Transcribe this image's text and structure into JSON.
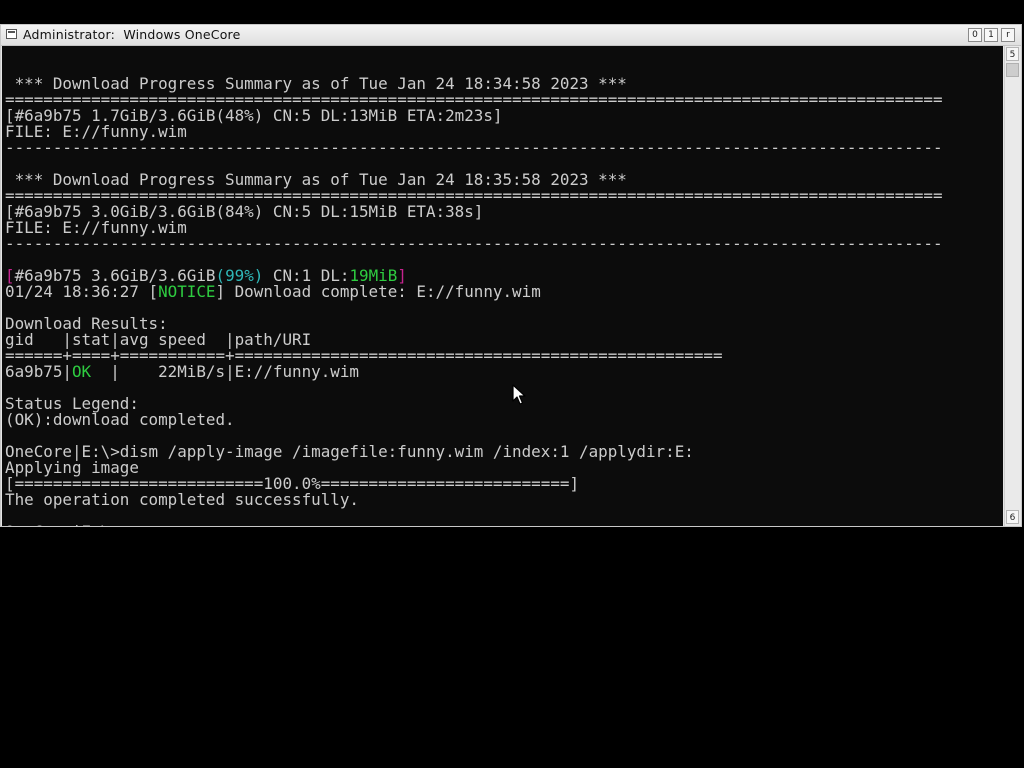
{
  "window": {
    "title": "Administrator:  Windows OneCore",
    "buttons": {
      "minimize": "0",
      "maximize": "1",
      "close": "r"
    }
  },
  "scrollbar": {
    "up_arrow": "5",
    "down_arrow": "6"
  },
  "console": {
    "lines": [
      [
        {
          "t": "",
          "c": ""
        }
      ],
      [
        {
          "t": " *** Download Progress Summary as of Tue Jan 24 18:34:58 2023 ***",
          "c": ""
        }
      ],
      [
        {
          "t": "==================================================================================================",
          "c": ""
        }
      ],
      [
        {
          "t": "[#6a9b75 1.7GiB/3.6GiB(48%) CN:5 DL:13MiB ETA:2m23s]",
          "c": ""
        }
      ],
      [
        {
          "t": "FILE: E://funny.wim",
          "c": ""
        }
      ],
      [
        {
          "t": "--------------------------------------------------------------------------------------------------",
          "c": ""
        }
      ],
      [
        {
          "t": "",
          "c": ""
        }
      ],
      [
        {
          "t": " *** Download Progress Summary as of Tue Jan 24 18:35:58 2023 ***",
          "c": ""
        }
      ],
      [
        {
          "t": "==================================================================================================",
          "c": ""
        }
      ],
      [
        {
          "t": "[#6a9b75 3.0GiB/3.6GiB(84%) CN:5 DL:15MiB ETA:38s]",
          "c": ""
        }
      ],
      [
        {
          "t": "FILE: E://funny.wim",
          "c": ""
        }
      ],
      [
        {
          "t": "--------------------------------------------------------------------------------------------------",
          "c": ""
        }
      ],
      [
        {
          "t": "",
          "c": ""
        }
      ],
      [
        {
          "t": "[",
          "c": "c-mag"
        },
        {
          "t": "#6a9b75 3.6GiB/3.6GiB",
          "c": ""
        },
        {
          "t": "(99%)",
          "c": "c-cyan"
        },
        {
          "t": " CN:1 DL:",
          "c": ""
        },
        {
          "t": "19MiB",
          "c": "c-green"
        },
        {
          "t": "]",
          "c": "c-mag"
        }
      ],
      [
        {
          "t": "01/24 18:36:27 [",
          "c": ""
        },
        {
          "t": "NOTICE",
          "c": "c-green"
        },
        {
          "t": "] Download complete: E://funny.wim",
          "c": ""
        }
      ],
      [
        {
          "t": "",
          "c": ""
        }
      ],
      [
        {
          "t": "Download Results:",
          "c": ""
        }
      ],
      [
        {
          "t": "gid   |stat|avg speed  |path/URI",
          "c": ""
        }
      ],
      [
        {
          "t": "======+====+===========+===================================================",
          "c": ""
        }
      ],
      [
        {
          "t": "6a9b75|",
          "c": ""
        },
        {
          "t": "OK",
          "c": "c-green"
        },
        {
          "t": "  |    22MiB/s|E://funny.wim",
          "c": ""
        }
      ],
      [
        {
          "t": "",
          "c": ""
        }
      ],
      [
        {
          "t": "Status Legend:",
          "c": ""
        }
      ],
      [
        {
          "t": "(OK):download completed.",
          "c": ""
        }
      ],
      [
        {
          "t": "",
          "c": ""
        }
      ],
      [
        {
          "t": "OneCore|E:\\>dism /apply-image /imagefile:funny.wim /index:1 /applydir:E:",
          "c": ""
        }
      ],
      [
        {
          "t": "Applying image",
          "c": ""
        }
      ],
      [
        {
          "t": "[==========================100.0%==========================]",
          "c": ""
        }
      ],
      [
        {
          "t": "The operation completed successfully.",
          "c": ""
        }
      ],
      [
        {
          "t": "",
          "c": ""
        }
      ],
      [
        {
          "t": "OneCore|E:\\>",
          "c": ""
        }
      ]
    ]
  },
  "colors": {
    "console_background": "#0c0c0c",
    "console_text": "#cccccc",
    "bracket_magenta": "#c5238e",
    "percent_cyan": "#2fb8b8",
    "status_green": "#2ecc40",
    "desktop_background": "#000000"
  },
  "icons": {
    "window_icon": "console-window-icon",
    "cursor": "mouse-pointer-icon"
  }
}
